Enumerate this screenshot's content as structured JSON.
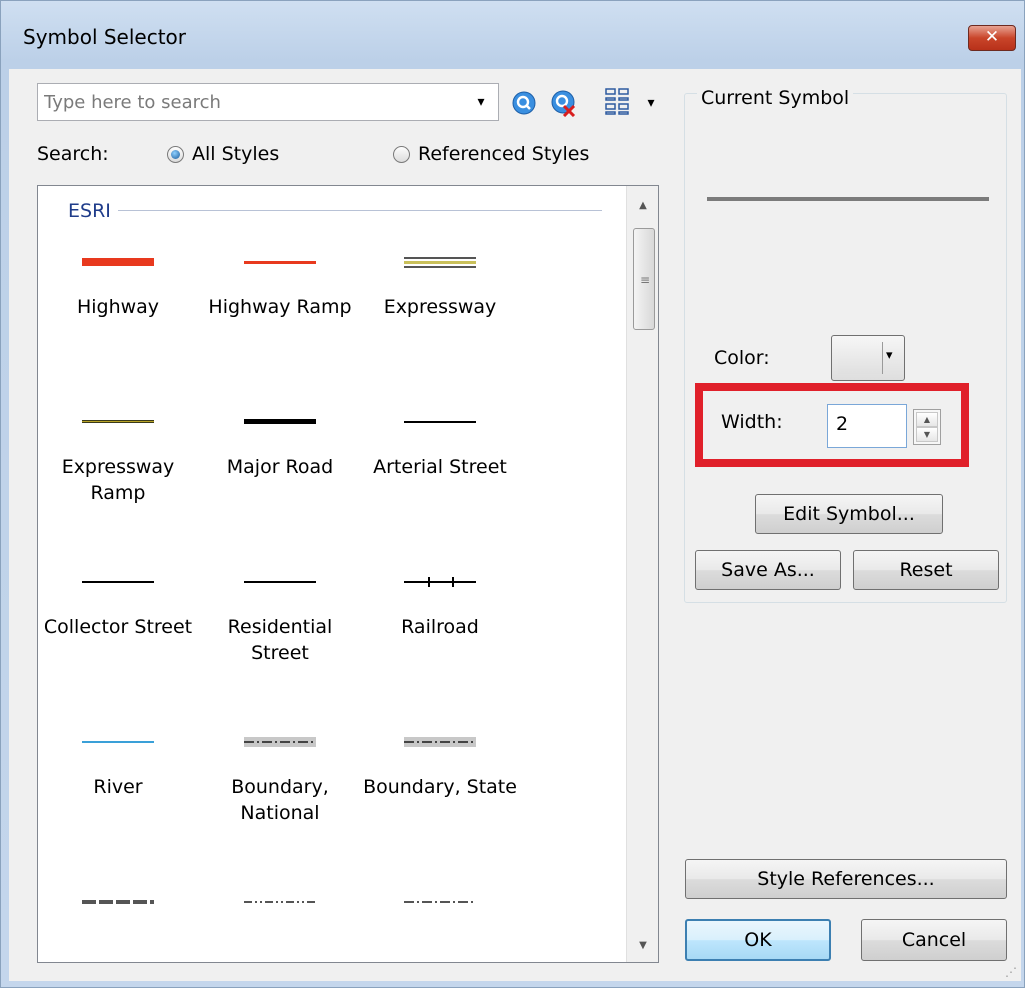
{
  "window": {
    "title": "Symbol Selector",
    "close_glyph": "✕"
  },
  "search": {
    "placeholder": "Type here to search",
    "value": "",
    "label": "Search:",
    "options": [
      {
        "label": "All Styles",
        "checked": true
      },
      {
        "label": "Referenced Styles",
        "checked": false
      }
    ]
  },
  "toolbar": {
    "icons": [
      "search-icon",
      "clear-search-icon",
      "view-options-icon"
    ],
    "dropdown_glyph": "▾"
  },
  "symbol_list": {
    "group": "ESRI",
    "items": [
      {
        "label": "Highway",
        "color": "#e8391e",
        "style": "thick"
      },
      {
        "label": "Highway Ramp",
        "color": "#e8391e",
        "style": "medium"
      },
      {
        "label": "Expressway",
        "color": "#8a8a3a",
        "style": "triple"
      },
      {
        "label": "Expressway Ramp",
        "color": "#b8a326",
        "style": "thin-yellow"
      },
      {
        "label": "Major Road",
        "color": "#000000",
        "style": "thick-black"
      },
      {
        "label": "Arterial Street",
        "color": "#000000",
        "style": "thin"
      },
      {
        "label": "Collector Street",
        "color": "#000000",
        "style": "thin"
      },
      {
        "label": "Residential Street",
        "color": "#000000",
        "style": "thin"
      },
      {
        "label": "Railroad",
        "color": "#000000",
        "style": "rail"
      },
      {
        "label": "River",
        "color": "#3aa0d8",
        "style": "thin-blue"
      },
      {
        "label": "Boundary, National",
        "color": "#9a9a9a",
        "style": "boundary"
      },
      {
        "label": "Boundary, State",
        "color": "#9a9a9a",
        "style": "boundary"
      },
      {
        "label": "",
        "color": "#555555",
        "style": "dash-thick"
      },
      {
        "label": "",
        "color": "#555555",
        "style": "dash-dot"
      },
      {
        "label": "",
        "color": "#555555",
        "style": "dash-dot2"
      }
    ]
  },
  "current_symbol": {
    "legend": "Current Symbol",
    "preview_color": "#7b7b7b",
    "color_label": "Color:",
    "width_label": "Width:",
    "width_value": "2",
    "edit_button": "Edit Symbol...",
    "save_as_button": "Save As...",
    "reset_button": "Reset"
  },
  "footer": {
    "style_references_button": "Style References...",
    "ok_button": "OK",
    "cancel_button": "Cancel"
  },
  "colors": {
    "highlight": "#e0202a",
    "accent": "#3c7fb1"
  }
}
